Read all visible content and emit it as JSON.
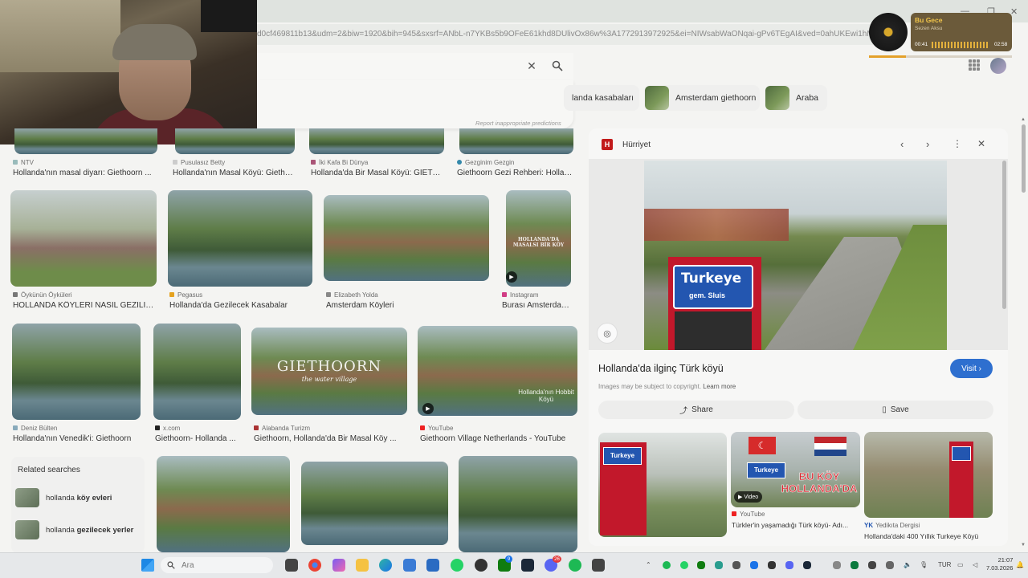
{
  "browser": {
    "url": "d0cf469811b13&udm=2&biw=1920&bih=945&sxsrf=ANbL-n7YKBs5b9OFeE61khd8DUlivOx86w%3A1772913972925&ei=NIWsabWaONqai-gPv6TEgAI&ved=0ahUKEwi1hMucy46TAxVa"
  },
  "search": {
    "report_text": "Report inappropriate predictions"
  },
  "chips": [
    {
      "label": "landa kasabaları"
    },
    {
      "label": "Amsterdam giethoorn"
    },
    {
      "label": "Araba"
    }
  ],
  "music_player": {
    "title": "Bu Gece",
    "artist": "Sezen Aksu",
    "elapsed": "00:41",
    "duration": "02:58",
    "progress": 0.26
  },
  "results": {
    "row1": [
      {
        "source": "NTV",
        "caption": "Hollanda'nın masal diyarı: Giethoorn ..."
      },
      {
        "source": "Pusulasız Betty",
        "caption": "Hollanda'nın Masal Köyü: Gietho..."
      },
      {
        "source": "İki Kafa Bi Dünya",
        "caption": "Hollanda'da Bir Masal Köyü: GIETH..."
      },
      {
        "source": "Gezginim Gezgin",
        "caption": "Giethoorn Gezi Rehberi: Hollan..."
      }
    ],
    "row2": [
      {
        "source": "Öykünün Öyküleri",
        "caption": "HOLLANDA KÖYLERİ NASIL GEZİLİR ..."
      },
      {
        "source": "Pegasus",
        "caption": "Hollanda'da Gezilecek Kasabalar"
      },
      {
        "source": "Elizabeth Yolda",
        "caption": "Amsterdam Köyleri"
      },
      {
        "source": "Instagram",
        "caption": "Burası Amsterdam'...",
        "overlay": "HOLLANDA'DA MASALSI BİR KÖY"
      }
    ],
    "row3": [
      {
        "source": "Deniz Bülten",
        "caption": "Hollanda'nın Venedik'i: Giethoorn"
      },
      {
        "source": "x.com",
        "caption": "Giethoorn- Hollanda ..."
      },
      {
        "source": "Alabanda Turizm",
        "caption": "Giethoorn, Hollanda'da Bir Masal Köy ...",
        "overlay": "GIETHOORN",
        "overlay_sub": "the water village"
      },
      {
        "source": "YouTube",
        "caption": "Giethoorn Village Netherlands - YouTube",
        "overlay": "Hollanda'nın Hobbit Köyü"
      }
    ]
  },
  "related_searches": {
    "title": "Related searches",
    "items": [
      {
        "prefix": "hollanda ",
        "bold": "köy evleri"
      },
      {
        "prefix": "hollanda ",
        "bold": "gezilecek yerler"
      }
    ]
  },
  "preview": {
    "source": "Hürriyet",
    "logo_letter": "H",
    "sign_text": "Turkeye",
    "sign_sub": "gem. Sluis",
    "title": "Hollanda'da ilginç Türk köyü",
    "visit_label": "Visit",
    "copyright_text": "Images may be subject to copyright.",
    "learn_more": "Learn more",
    "share_label": "Share",
    "save_label": "Save",
    "related": [
      {
        "source": "",
        "caption": "",
        "sign": "Turkeye"
      },
      {
        "source": "YouTube",
        "caption": "Türkler'in yaşamadığı Türk köyü- Adı...",
        "video_label": "Video",
        "overlay": "BU KÖY HOLLANDA'DA",
        "sign": "Turkeye"
      },
      {
        "source": "Yedikıta Dergisi",
        "caption": "Hollanda'daki 400 Yıllık Turkeye Köyü"
      }
    ]
  },
  "taskbar": {
    "search_placeholder": "Ara",
    "language": "TUR",
    "time": "21:07",
    "date": "7.03.2026",
    "badges": {
      "game": "9",
      "discord": "26"
    }
  },
  "colors": {
    "accent_blue": "#2e6fcf",
    "hurriyet_red": "#c21a1a",
    "music_gold": "#f0c44a"
  }
}
